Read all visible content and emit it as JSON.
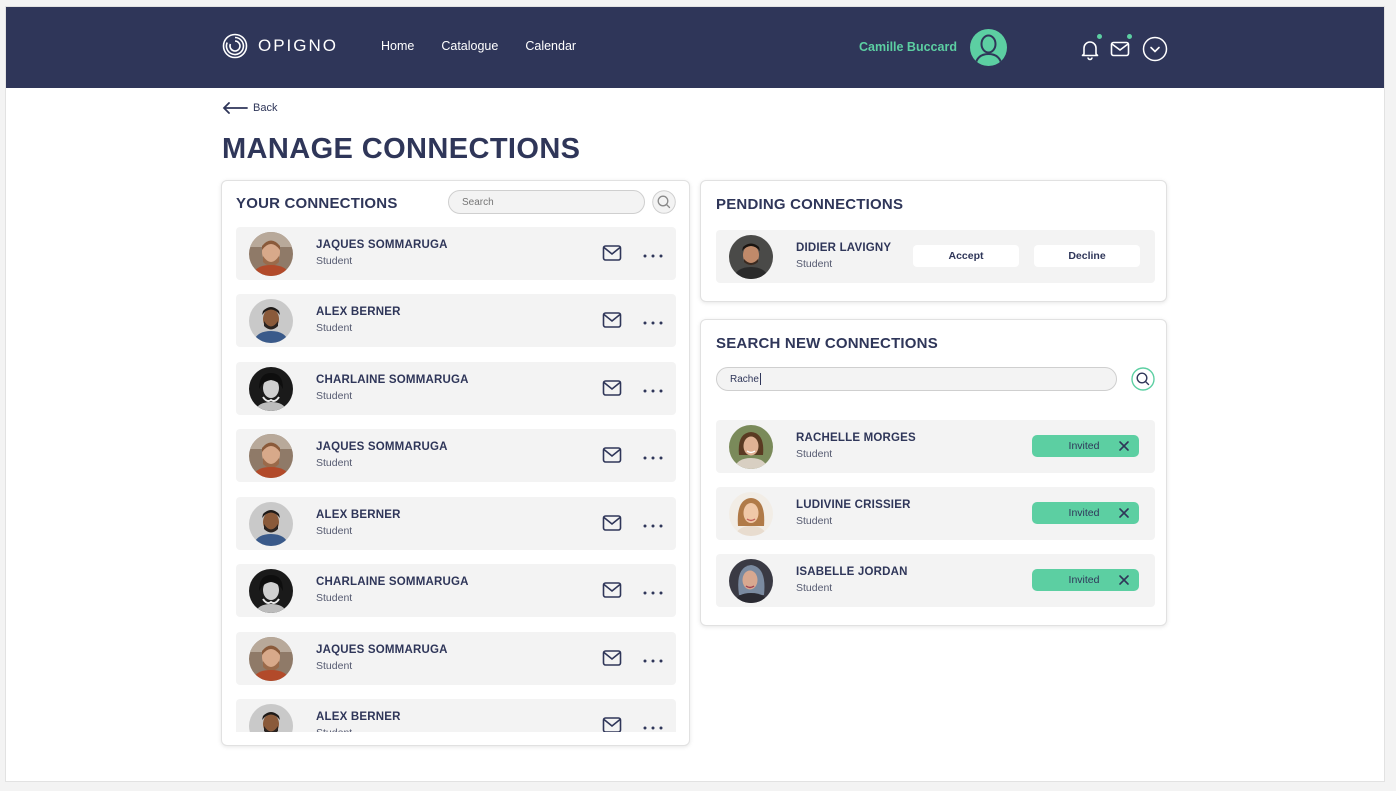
{
  "header": {
    "logo_text": "OPIGNO",
    "nav": [
      "Home",
      "Catalogue",
      "Calendar"
    ],
    "user_name": "Camille Buccard"
  },
  "back_label": "Back",
  "page_title": "MANAGE CONNECTIONS",
  "your_connections": {
    "title": "YOUR CONNECTIONS",
    "search_placeholder": "Search",
    "items": [
      {
        "name": "JAQUES SOMMARUGA",
        "role": "Student"
      },
      {
        "name": "ALEX BERNER",
        "role": "Student"
      },
      {
        "name": "CHARLAINE SOMMARUGA",
        "role": "Student"
      },
      {
        "name": "JAQUES SOMMARUGA",
        "role": "Student"
      },
      {
        "name": "ALEX BERNER",
        "role": "Student"
      },
      {
        "name": "CHARLAINE SOMMARUGA",
        "role": "Student"
      },
      {
        "name": "JAQUES SOMMARUGA",
        "role": "Student"
      },
      {
        "name": "ALEX BERNER",
        "role": "Student"
      }
    ]
  },
  "pending": {
    "title": "PENDING CONNECTIONS",
    "item": {
      "name": "DIDIER LAVIGNY",
      "role": "Student"
    },
    "accept_label": "Accept",
    "decline_label": "Decline"
  },
  "search_new": {
    "title": "SEARCH NEW CONNECTIONS",
    "query": "Rache",
    "status_label": "Invited",
    "results": [
      {
        "name": "RACHELLE MORGES",
        "role": "Student"
      },
      {
        "name": "LUDIVINE CRISSIER",
        "role": "Student"
      },
      {
        "name": "ISABELLE JORDAN",
        "role": "Student"
      }
    ]
  },
  "colors": {
    "navy": "#2f3659",
    "accent": "#5ccfa2",
    "row_bg": "#f3f3f3"
  }
}
